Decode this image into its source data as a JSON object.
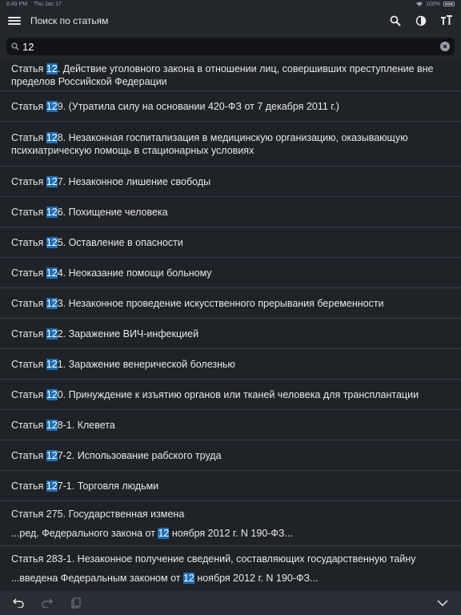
{
  "status_bar": {
    "time": "8:49 PM",
    "date": "Thu Jan 17",
    "battery": "100%"
  },
  "header": {
    "title": "Поиск по статьям"
  },
  "search": {
    "value": "12"
  },
  "results": [
    {
      "pre": "Статья ",
      "hl": "12",
      "post": ". Действие уголовного закона в отношении лиц, совершивших преступление вне",
      "line2": "пределов Российской Федерации"
    },
    {
      "pre": "Статья ",
      "hl": "12",
      "post": "9. (Утратила силу на основании 420-ФЗ от 7 декабря 2011 г.)"
    },
    {
      "pre": "Статья ",
      "hl": "12",
      "post": "8. Незаконная госпитализация в медицинскую организацию, оказывающую",
      "line2": "психиатрическую помощь в стационарных условиях"
    },
    {
      "pre": "Статья ",
      "hl": "12",
      "post": "7. Незаконное лишение свободы"
    },
    {
      "pre": "Статья ",
      "hl": "12",
      "post": "6. Похищение человека"
    },
    {
      "pre": "Статья ",
      "hl": "12",
      "post": "5. Оставление в опасности"
    },
    {
      "pre": "Статья ",
      "hl": "12",
      "post": "4. Неоказание помощи больному"
    },
    {
      "pre": "Статья ",
      "hl": "12",
      "post": "3. Незаконное проведение искусственного прерывания беременности"
    },
    {
      "pre": "Статья ",
      "hl": "12",
      "post": "2. Заражение ВИЧ-инфекцией"
    },
    {
      "pre": "Статья ",
      "hl": "12",
      "post": "1. Заражение венерической болезнью"
    },
    {
      "pre": "Статья ",
      "hl": "12",
      "post": "0. Принуждение к изъятию органов или тканей человека для трансплантации"
    },
    {
      "pre": "Статья ",
      "hl": "12",
      "post": "8-1. Клевета"
    },
    {
      "pre": "Статья ",
      "hl": "12",
      "post": "7-2. Использование рабского труда"
    },
    {
      "pre": "Статья ",
      "hl": "12",
      "post": "7-1. Торговля людьми"
    },
    {
      "pre": "Статья 275. Государственная измена",
      "snippet_pre": "...ред.  Федерального закона от ",
      "snippet_hl": "12",
      "snippet_post": " ноября 2012 г. N 190-ФЗ..."
    },
    {
      "pre": "Статья 283-1. Незаконное получение сведений, составляющих государственную тайну",
      "snippet_pre": "...введена  Федеральным законом от ",
      "snippet_hl": "12",
      "snippet_post": " ноября 2012 г. N 190-ФЗ..."
    }
  ],
  "icons": {
    "menu": "hamburger-icon",
    "search": "search-icon",
    "theme": "contrast-icon",
    "font": "font-size-icon",
    "clear": "clear-icon",
    "undo": "undo-icon",
    "redo": "redo-icon",
    "clipboard": "clipboard-icon",
    "collapse": "chevron-down-icon"
  },
  "colors": {
    "background": "#1f2227",
    "highlight": "#1f6fb5",
    "header": "#23262b"
  }
}
